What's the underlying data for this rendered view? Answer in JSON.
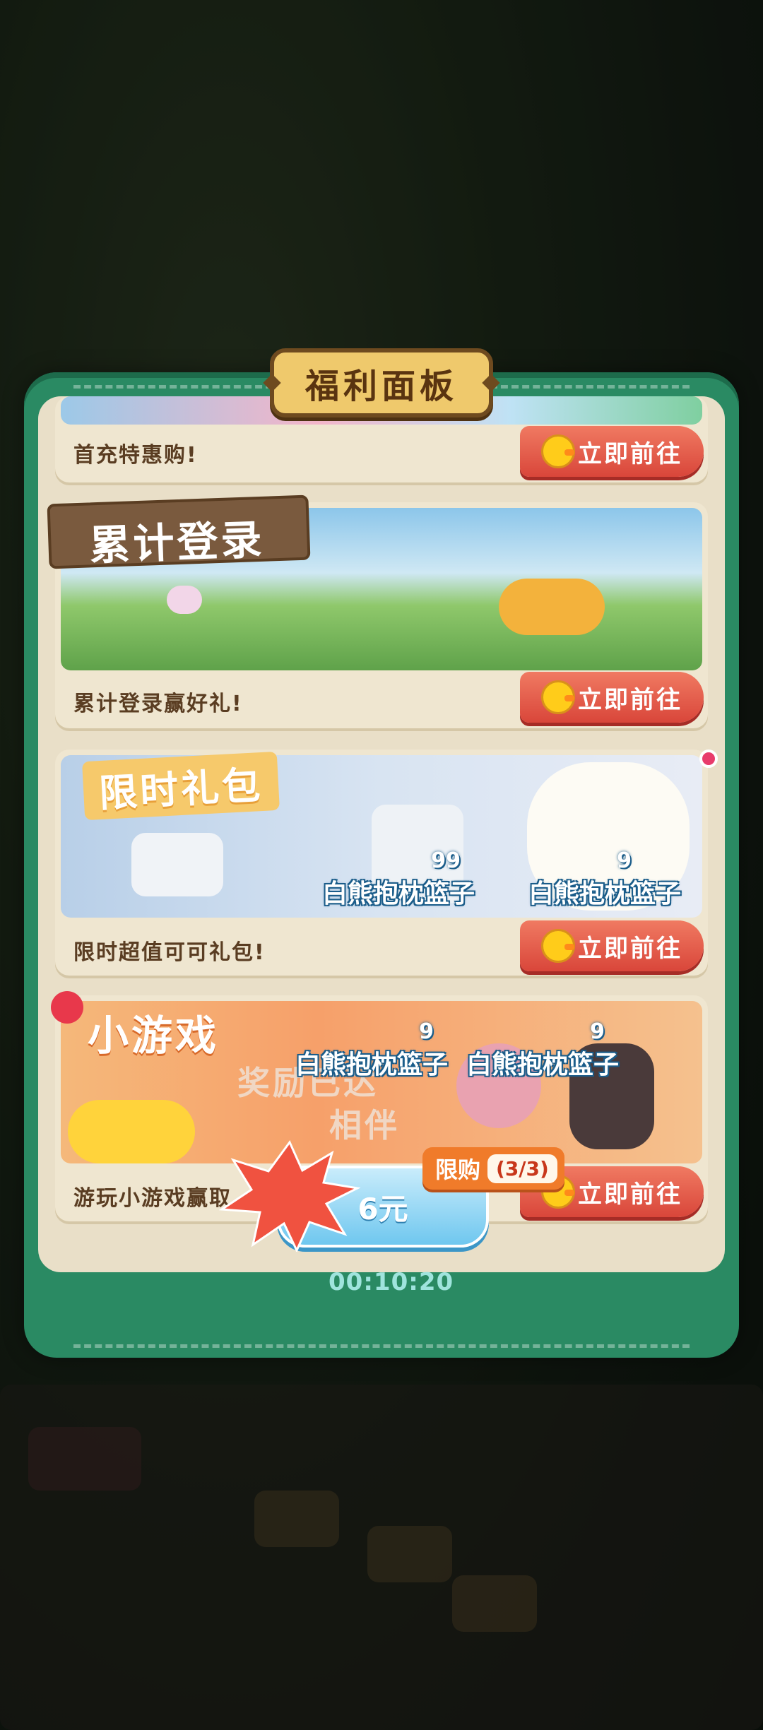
{
  "panel": {
    "title": "福利面板"
  },
  "cards": [
    {
      "desc": "首充特惠购!",
      "button": "立即前往"
    },
    {
      "banner_title": "累计登录",
      "desc": "累计登录赢好礼!",
      "button": "立即前往"
    },
    {
      "banner_title": "限时礼包",
      "desc": "限时超值可可礼包!",
      "button": "立即前往",
      "rewards": [
        {
          "qty": "99",
          "name": "白熊抱枕篮子"
        },
        {
          "qty": "9",
          "name": "白熊抱枕篮子"
        }
      ]
    },
    {
      "banner_title": "小游戏",
      "desc": "游玩小游戏赢取",
      "button": "立即前往",
      "banner_text_1": "奖励已达",
      "banner_text_2": "相伴",
      "rewards": [
        {
          "qty": "9",
          "name": "白熊抱枕篮子"
        },
        {
          "qty": "9",
          "name": "白熊抱枕篮子"
        }
      ]
    }
  ],
  "offer": {
    "price": "6元",
    "limit_label": "限购",
    "limit_count": "(3/3)",
    "timer": "00:10:20"
  },
  "colors": {
    "panel_green": "#2a8a63",
    "button_red": "#d9463a",
    "price_blue": "#6fc7ef",
    "limit_orange": "#f07b2a"
  }
}
